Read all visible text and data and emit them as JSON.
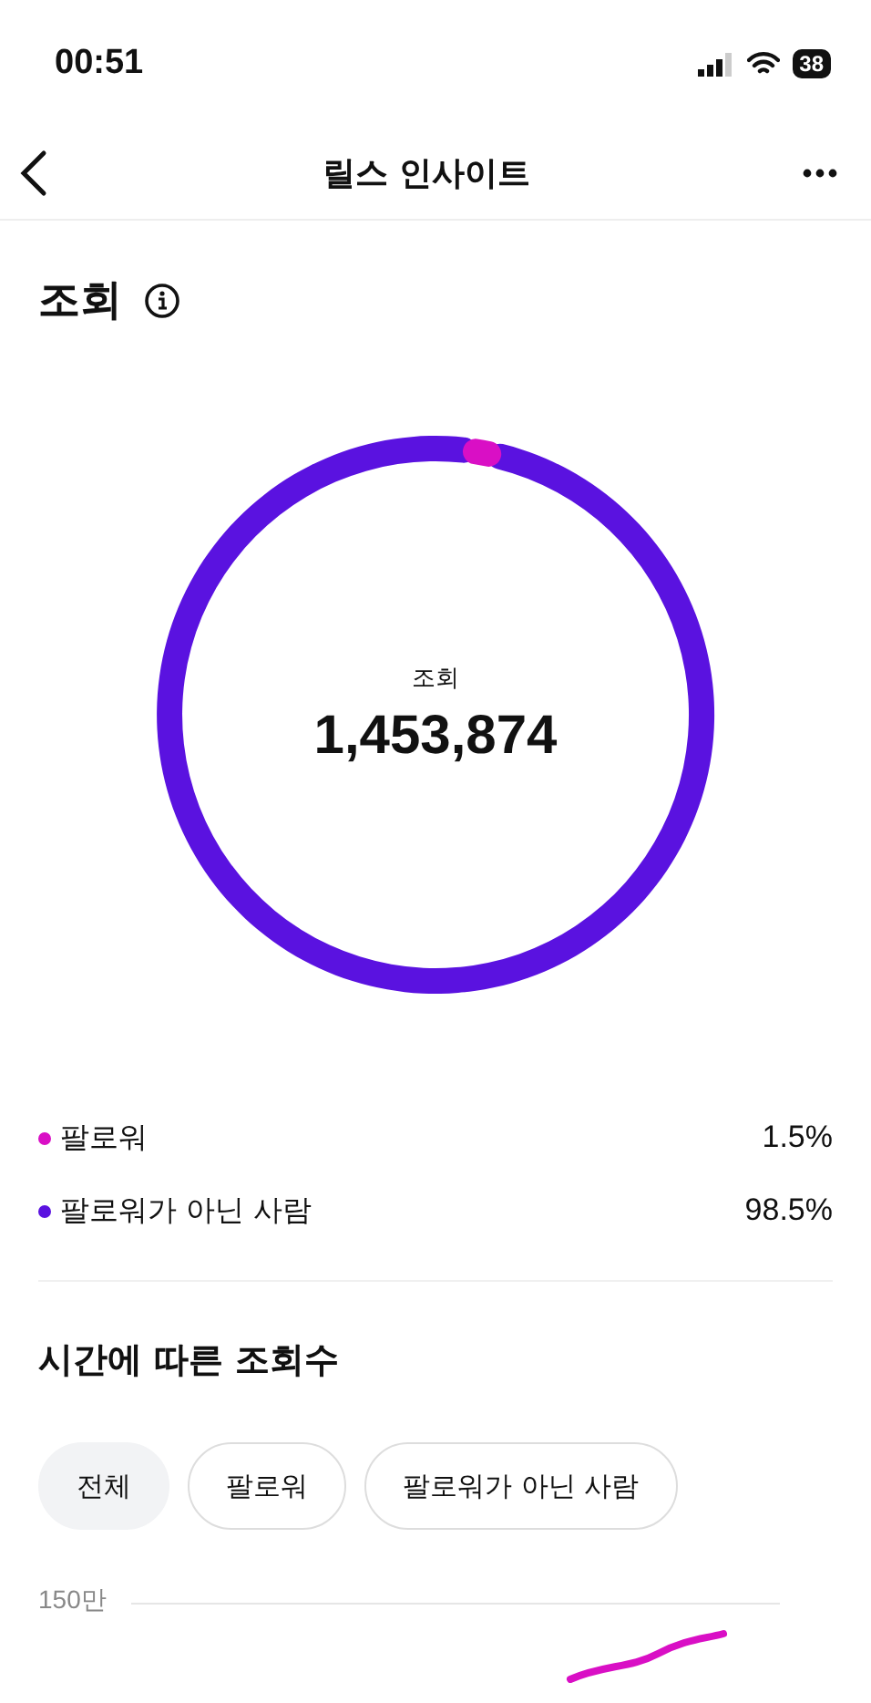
{
  "status_bar": {
    "time": "00:51",
    "battery": "38"
  },
  "header": {
    "title": "릴스 인사이트"
  },
  "views": {
    "title": "조회",
    "center_label": "조회",
    "total": "1,453,874",
    "chart_data": {
      "type": "donut",
      "values": [
        98.5,
        1.5
      ]
    },
    "legend": [
      {
        "label": "팔로워",
        "value": "1.5%",
        "color": "#d90fc5"
      },
      {
        "label": "팔로워가 아닌 사람",
        "value": "98.5%",
        "color": "#5a12e0"
      }
    ]
  },
  "over_time": {
    "title": "시간에 따른 조회수",
    "filters": [
      {
        "label": "전체",
        "selected": true
      },
      {
        "label": "팔로워",
        "selected": false
      },
      {
        "label": "팔로워가 아닌 사람",
        "selected": false
      }
    ],
    "y_tick_label": "150만"
  }
}
